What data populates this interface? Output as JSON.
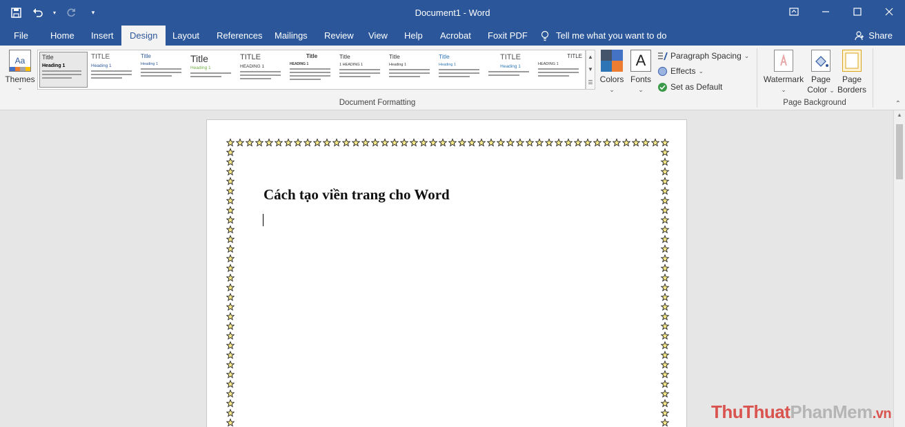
{
  "titlebar": {
    "title": "Document1  -  Word"
  },
  "tabs": [
    {
      "label": "File",
      "id": "file"
    },
    {
      "label": "Home",
      "id": "home"
    },
    {
      "label": "Insert",
      "id": "insert"
    },
    {
      "label": "Design",
      "id": "design",
      "active": true
    },
    {
      "label": "Layout",
      "id": "layout"
    },
    {
      "label": "References",
      "id": "references"
    },
    {
      "label": "Mailings",
      "id": "mailings"
    },
    {
      "label": "Review",
      "id": "review"
    },
    {
      "label": "View",
      "id": "view"
    },
    {
      "label": "Help",
      "id": "help"
    },
    {
      "label": "Acrobat",
      "id": "acrobat"
    },
    {
      "label": "Foxit PDF",
      "id": "foxit-pdf"
    }
  ],
  "tell_me": "Tell me what you want to do",
  "share": "Share",
  "ribbon": {
    "themes_label": "Themes",
    "document_formatting_label": "Document Formatting",
    "styles": [
      {
        "title": "Title",
        "heading": "Heading 1"
      },
      {
        "title": "TITLE",
        "heading": "Heading 1"
      },
      {
        "title": "Title",
        "heading": "Heading 1"
      },
      {
        "title": "Title",
        "heading": "Heading 1"
      },
      {
        "title": "TITLE",
        "heading": "HEADING 1"
      },
      {
        "title": "Title",
        "heading": "HEADING 1"
      },
      {
        "title": "Title",
        "heading": "1   HEADING 1"
      },
      {
        "title": "Title",
        "heading": "Heading 1"
      },
      {
        "title": "Title",
        "heading": "Heading 1"
      },
      {
        "title": "TITLE",
        "heading": "Heading 1"
      },
      {
        "title": "TITLE",
        "heading": "HEADING 1"
      }
    ],
    "colors_label": "Colors",
    "fonts_label": "Fonts",
    "fonts_glyph": "A",
    "paragraph_spacing_label": "Paragraph Spacing",
    "effects_label": "Effects",
    "set_default_label": "Set as Default",
    "watermark_label": "Watermark",
    "page_color_label_1": "Page",
    "page_color_label_2": "Color",
    "page_borders_label_1": "Page",
    "page_borders_label_2": "Borders",
    "page_background_label": "Page Background",
    "themes_glyph": "Aa"
  },
  "document": {
    "heading": "Cách tạo viền trang cho Word"
  },
  "site_watermark": {
    "part1": "ThuThuat",
    "part2": "PhanMem",
    "part3": ".vn"
  },
  "colors": {
    "titlebar": "#2b579a",
    "ribbon": "#f3f3f3",
    "workspace": "#e6e6e6"
  }
}
